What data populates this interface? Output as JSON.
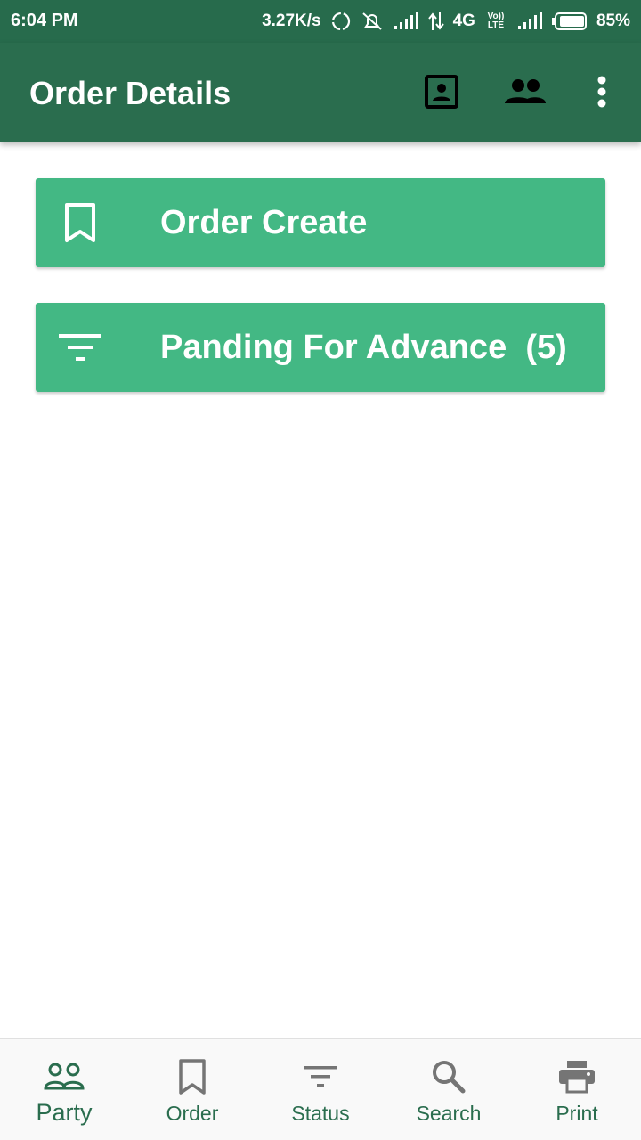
{
  "status_bar": {
    "time": "6:04 PM",
    "speed": "3.27K/s",
    "network": "4G",
    "volte": "Vo)) LTE",
    "battery": "85%"
  },
  "app_bar": {
    "title": "Order Details",
    "icons": [
      "contact-icon",
      "group-icon",
      "more-vert-icon"
    ]
  },
  "cards": [
    {
      "label": "Order Create",
      "icon": "bookmark-icon"
    },
    {
      "label": "Panding For Advance  (5)",
      "icon": "filter-icon"
    }
  ],
  "bottom_nav": {
    "active": "Party",
    "items": [
      {
        "label": "Party",
        "icon": "people-outline-icon"
      },
      {
        "label": "Order",
        "icon": "bookmark-icon"
      },
      {
        "label": "Status",
        "icon": "filter-icon"
      },
      {
        "label": "Search",
        "icon": "search-icon"
      },
      {
        "label": "Print",
        "icon": "print-icon"
      }
    ]
  },
  "colors": {
    "primary_dark": "#276b4c",
    "primary": "#2a6d4e",
    "accent": "#43b884"
  }
}
